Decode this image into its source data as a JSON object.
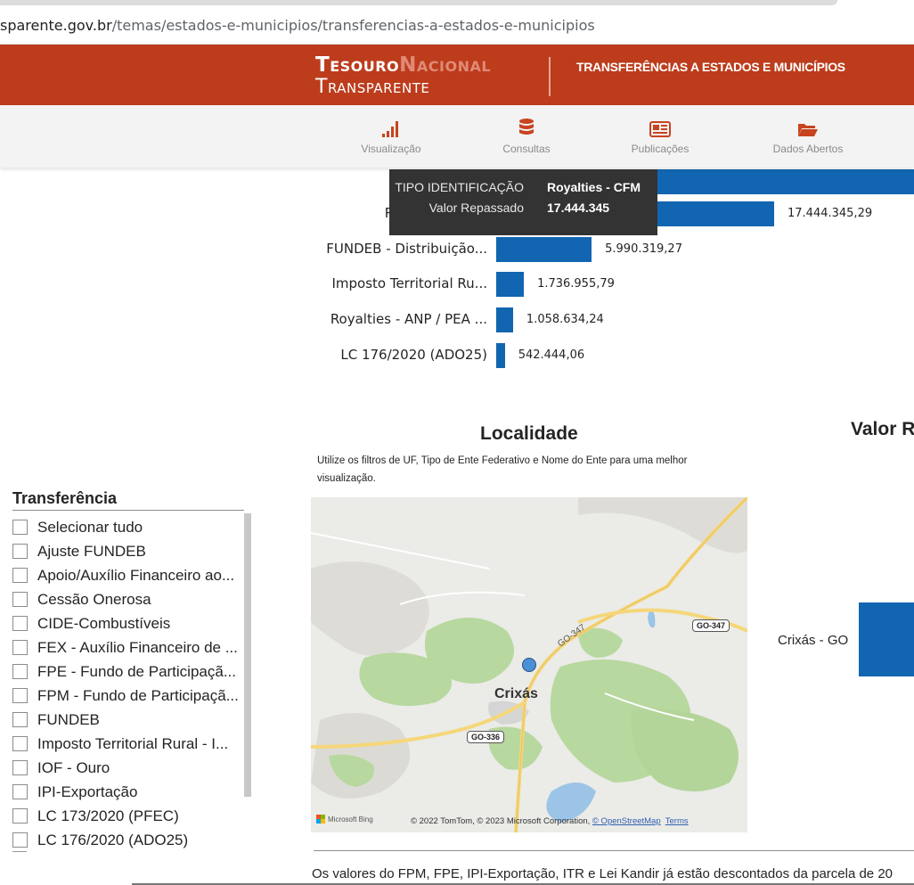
{
  "browser": {
    "url_host": "sparente.gov.br",
    "url_path": "/temas/estados-e-municipios/transferencias-a-estados-e-municipios"
  },
  "header": {
    "logo_word1": "Tesouro",
    "logo_word2": "Nacional",
    "logo_word3": "Transparente",
    "title": "TRANSFERÊNCIAS A ESTADOS E MUNICÍPIOS"
  },
  "nav": {
    "items": [
      {
        "label": "Visualização",
        "icon": "bar-chart-icon"
      },
      {
        "label": "Consultas",
        "icon": "database-icon"
      },
      {
        "label": "Publicações",
        "icon": "newspaper-icon"
      },
      {
        "label": "Dados Abertos",
        "icon": "folder-open-icon"
      }
    ]
  },
  "chart_data": {
    "type": "bar",
    "orientation": "horizontal",
    "categories": [
      "FPM - Fu",
      "Royalties - CFM",
      "FUNDEB - Distribuição...",
      "Imposto Territorial Ru...",
      "Royalties - ANP / PEA ...",
      "LC 176/2020 (ADO25)"
    ],
    "values": [
      null,
      17444345.29,
      5990319.27,
      1736955.79,
      1058634.24,
      542444.06
    ],
    "value_labels": [
      "",
      "17.444.345,29",
      "5.990.319,27",
      "1.736.955,79",
      "1.058.634,24",
      "542.444,06"
    ],
    "bar_color": "#1265b0"
  },
  "tooltip": {
    "key1": "TIPO IDENTIFICAÇÃO",
    "val1": "Royalties - CFM",
    "key2": "Valor Repassado",
    "val2": "17.444.345"
  },
  "localidade": {
    "title": "Localidade",
    "subtitle": "Utilize os filtros de UF, Tipo de Ente Federativo e Nome do Ente para uma melhor visualização.",
    "map": {
      "city": "Crixás",
      "shield1": "GO-347",
      "shield2": "GO-336",
      "road_label": "GO-347",
      "bing_text": "Microsoft Bing",
      "attribution": "© 2022 TomTom, © 2023 Microsoft Corporation, ",
      "osm_link": "© OpenStreetMap",
      "terms_link": "Terms"
    }
  },
  "valor": {
    "title": "Valor R",
    "entity_label": "Crixás - GO"
  },
  "slicer": {
    "title": "Transferência",
    "items": [
      "Selecionar tudo",
      "Ajuste FUNDEB",
      "Apoio/Auxílio Financeiro ao...",
      "Cessão Onerosa",
      "CIDE-Combustíveis",
      "FEX - Auxílio Financeiro de ...",
      "FPE - Fundo de Participaçã...",
      "FPM - Fundo de Participaçã...",
      "FUNDEB",
      "Imposto Territorial Rural - I...",
      "IOF - Ouro",
      "IPI-Exportação",
      "LC 173/2020 (PFEC)",
      "LC 176/2020 (ADO25)"
    ]
  },
  "footer": {
    "text": "Os valores do FPM, FPE, IPI-Exportação, ITR e Lei Kandir já estão descontados da parcela de 20"
  }
}
